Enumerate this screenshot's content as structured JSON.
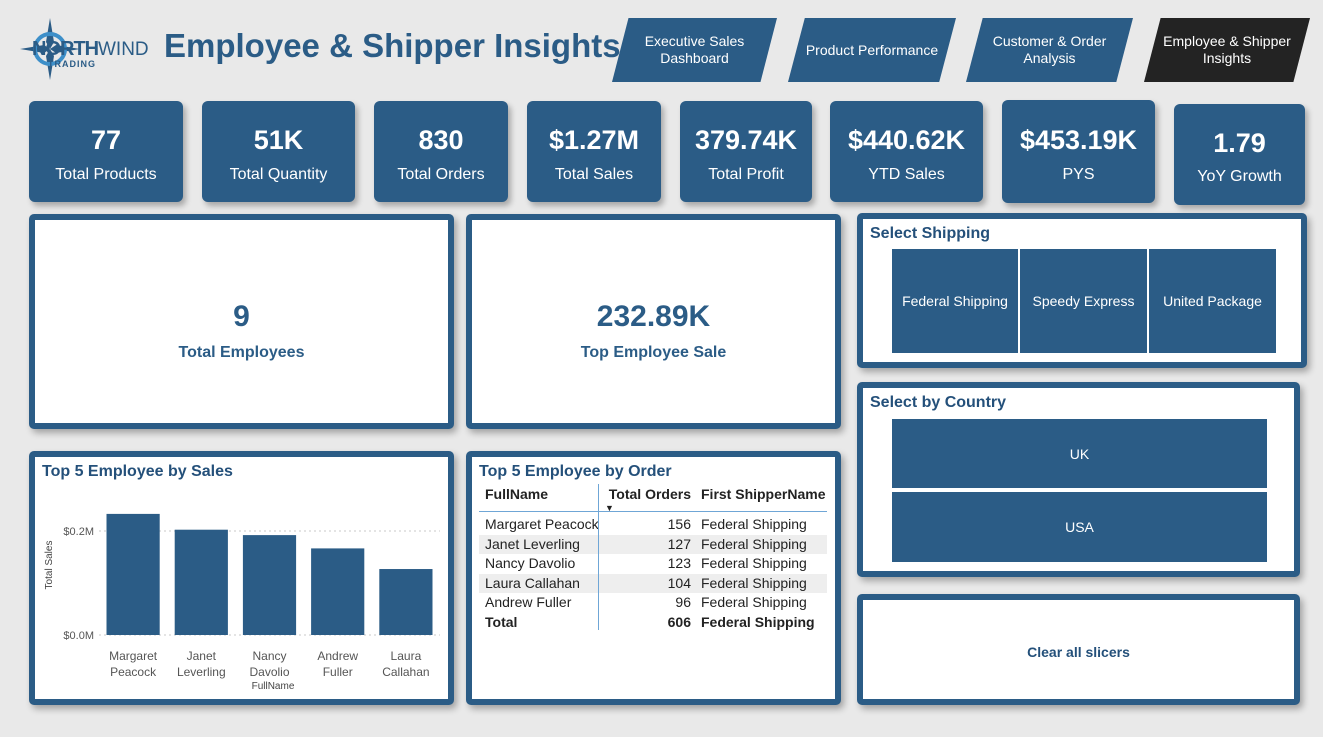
{
  "header": {
    "logo_text_north": "NORTH",
    "logo_text_wind": "WIND",
    "logo_text_trading": "TRADING",
    "title": "Employee & Shipper Insights"
  },
  "nav": {
    "tabs": [
      {
        "label": "Executive Sales\nDashboard",
        "active": false
      },
      {
        "label": "Product Performance",
        "active": false
      },
      {
        "label": "Customer & Order\nAnalysis",
        "active": false
      },
      {
        "label": "Employee & Shipper\nInsights",
        "active": true
      }
    ]
  },
  "kpis": [
    {
      "value": "77",
      "label": "Total Products"
    },
    {
      "value": "51K",
      "label": "Total Quantity"
    },
    {
      "value": "830",
      "label": "Total Orders"
    },
    {
      "value": "$1.27M",
      "label": "Total Sales"
    },
    {
      "value": "379.74K",
      "label": "Total Profit"
    },
    {
      "value": "$440.62K",
      "label": "YTD Sales"
    },
    {
      "value": "$453.19K",
      "label": "PYS"
    },
    {
      "value": "1.79",
      "label": "YoY Growth"
    }
  ],
  "cards": {
    "employees": {
      "value": "9",
      "label": "Total Employees"
    },
    "top_sale": {
      "value": "232.89K",
      "label": "Top Employee Sale"
    }
  },
  "shipping_slicer": {
    "title": "Select Shipping",
    "options": [
      "Federal Shipping",
      "Speedy Express",
      "United Package"
    ]
  },
  "country_slicer": {
    "title": "Select by Country",
    "options": [
      "UK",
      "USA"
    ]
  },
  "clear_button": {
    "label": "Clear all slicers"
  },
  "orders_table": {
    "title": "Top 5 Employee by Order",
    "columns": [
      "FullName",
      "Total Orders",
      "First ShipperName"
    ],
    "rows": [
      [
        "Margaret Peacock",
        "156",
        "Federal Shipping"
      ],
      [
        "Janet Leverling",
        "127",
        "Federal Shipping"
      ],
      [
        "Nancy Davolio",
        "123",
        "Federal Shipping"
      ],
      [
        "Laura Callahan",
        "104",
        "Federal Shipping"
      ],
      [
        "Andrew Fuller",
        "96",
        "Federal Shipping"
      ]
    ],
    "total": [
      "Total",
      "606",
      "Federal Shipping"
    ]
  },
  "colors": {
    "accent": "#2b5c86",
    "active_tab": "#232323",
    "background": "#e9e9e9"
  },
  "chart_data": {
    "type": "bar",
    "title": "Top 5 Employee by Sales",
    "xlabel": "FullName",
    "ylabel": "Total Sales",
    "categories": [
      "Margaret Peacock",
      "Janet Leverling",
      "Nancy Davolio",
      "Andrew Fuller",
      "Laura Callahan"
    ],
    "category_lines": [
      [
        "Margaret",
        "Peacock"
      ],
      [
        "Janet",
        "Leverling"
      ],
      [
        "Nancy",
        "Davolio"
      ],
      [
        "Andrew",
        "Fuller"
      ],
      [
        "Laura",
        "Callahan"
      ]
    ],
    "values": [
      232890,
      202500,
      192110,
      166540,
      126860
    ],
    "ylim": [
      0,
      250000
    ],
    "yticks": [
      0,
      200000
    ],
    "ytick_labels": [
      "$0.0M",
      "$0.2M"
    ],
    "grid": true,
    "color": "#2b5c86"
  }
}
